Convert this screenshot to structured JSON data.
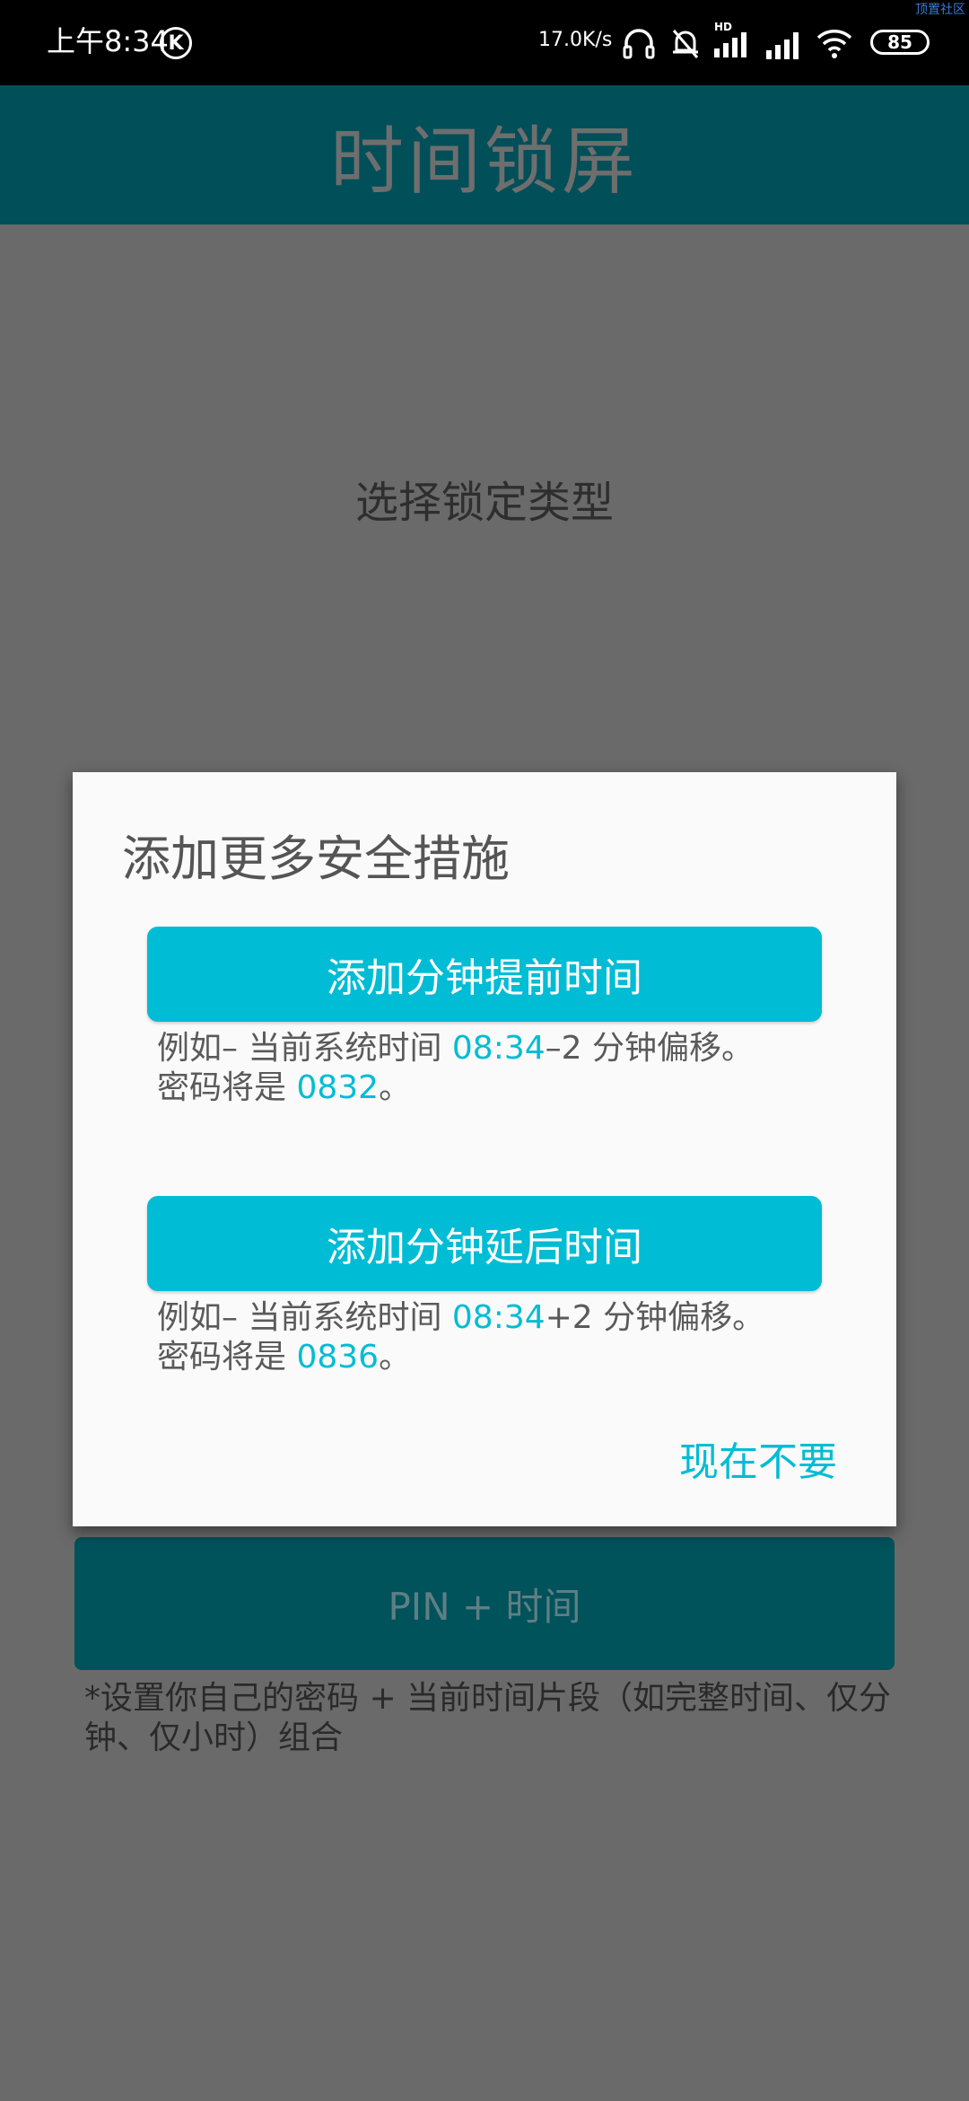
{
  "status_bar": {
    "time": "上午8:34",
    "k_icon": "K",
    "net_speed": "17.0K/s",
    "hd_label": "HD",
    "battery": "85",
    "watermark": "顶置社区",
    "icons": [
      "headset-icon",
      "mute-bell-icon",
      "signal-hd-icon",
      "signal-icon",
      "wifi-icon",
      "battery-icon"
    ]
  },
  "app_bar": {
    "title": "时间锁屏"
  },
  "content": {
    "heading": "选择锁定类型",
    "pin_time_button": "PIN + 时间",
    "pin_time_desc": "*设置你自己的密码 + 当前时间片段（如完整时间、仅分钟、仅小时）组合"
  },
  "dialog": {
    "title": "添加更多安全措施",
    "advance_button": "添加分钟提前时间",
    "advance_desc": {
      "prefix": "例如– 当前系统时间 ",
      "time": "08:34",
      "offset": "–2 分钟偏移。",
      "pwd_prefix": "密码将是 ",
      "pwd": "0832",
      "suffix": "。"
    },
    "delay_button": "添加分钟延后时间",
    "delay_desc": {
      "prefix": "例如– 当前系统时间 ",
      "time": "08:34",
      "offset": "+2 分钟偏移。",
      "pwd_prefix": "密码将是 ",
      "pwd": "0836",
      "suffix": "。"
    },
    "dismiss": "现在不要"
  },
  "colors": {
    "accent": "#00bcd4",
    "app_bar": "#004f59",
    "scrim": "#6a6a6a"
  }
}
